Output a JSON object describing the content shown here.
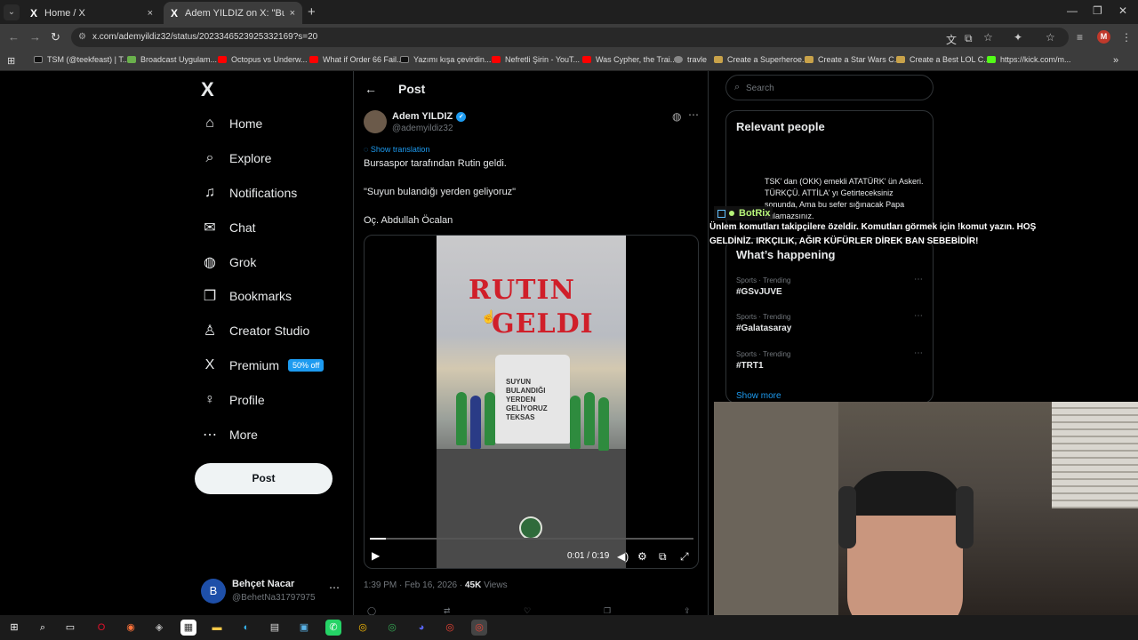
{
  "browser": {
    "tabs": [
      {
        "label": "Home / X",
        "close": "×"
      },
      {
        "label": "Adem YILDIZ on X: \"Bursaspor t",
        "close": "×"
      }
    ],
    "new_tab": "+",
    "url": "x.com/ademyildiz32/status/2023346523925332169?s=20",
    "bookmarks": [
      {
        "label": "TSM (@teekfeast) | T...",
        "color": "#000000"
      },
      {
        "label": "Broadcast Uygulam...",
        "color": "#6ab04c"
      },
      {
        "label": "Octopus vs Underw...",
        "color": "#ff0000"
      },
      {
        "label": "What if Order 66 Fail...",
        "color": "#ff0000"
      },
      {
        "label": "Yazımı kışa çevirdin...",
        "color": "#000000"
      },
      {
        "label": "Nefretli Şirin - YouT...",
        "color": "#ff0000"
      },
      {
        "label": "Was Cypher, the Trai...",
        "color": "#ff0000"
      },
      {
        "label": "travle",
        "color": "#888888"
      },
      {
        "label": "Create a Superheroe...",
        "color": "#c8a24a"
      },
      {
        "label": "Create a Star Wars C...",
        "color": "#c8a24a"
      },
      {
        "label": "Create a Best LOL C...",
        "color": "#c8a24a"
      },
      {
        "label": "https://kick.com/m...",
        "color": "#53fc18"
      }
    ],
    "profile_initial": "M"
  },
  "sidebar": {
    "logo": "X",
    "items": [
      {
        "label": "Home",
        "icon": "⌂"
      },
      {
        "label": "Explore",
        "icon": "⌕"
      },
      {
        "label": "Notifications",
        "icon": "♫"
      },
      {
        "label": "Chat",
        "icon": "✉"
      },
      {
        "label": "Grok",
        "icon": "◍"
      },
      {
        "label": "Bookmarks",
        "icon": "❐"
      },
      {
        "label": "Creator Studio",
        "icon": "♙"
      },
      {
        "label": "Premium",
        "icon": "X"
      },
      {
        "label": "Profile",
        "icon": "♀"
      },
      {
        "label": "More",
        "icon": "⋯"
      }
    ],
    "premium_badge": "50% off",
    "post_button": "Post",
    "account": {
      "initial": "B",
      "name": "Behçet Nacar",
      "handle": "@BehetNa31797975",
      "more": "⋯"
    }
  },
  "post": {
    "header": "Post",
    "author_name": "Adem YILDIZ",
    "author_handle": "@ademyildiz32",
    "show_translation": "Show translation",
    "lines": [
      "Bursaspor tarafından Rutin geldi.",
      "\"Suyun bulandığı yerden geliyoruz\"",
      "Oç. Abdullah Öcalan"
    ],
    "video": {
      "caption_line1": "RUTIN",
      "caption_line2": "GELDI",
      "van_text": "SUYUN\nBULANDIĞI\nYERDEN\nGELİYORUZ\nTEKSAS",
      "time": "0:01 / 0:19",
      "progress": 0.05
    },
    "timestamp": "1:39 PM · Feb 16, 2026 ·",
    "views_count": "45K",
    "views_label": "Views"
  },
  "right": {
    "search_placeholder": "Search",
    "relevant_title": "Relevant people",
    "relevant_bio": "TSK' dan (OKK) emekli ATATÜRK' ün Askeri. TÜRKÇÜ. ATTİLA' yı Getirteceksiniz sonunda, Ama bu sefer sığınacak Papa bulamazsınız.",
    "happening_title": "What’s happening",
    "trends": [
      {
        "category": "Sports · Trending",
        "name": "#GSvJUVE"
      },
      {
        "category": "Sports · Trending",
        "name": "#Galatasaray"
      },
      {
        "category": "Sports · Trending",
        "name": "#TRT1"
      }
    ],
    "show_more": "Show more"
  },
  "overlay": {
    "bot_name": "BotRix",
    "message": "Ünlem komutları takipçilere özeldir. Komutları görmek için !komut yazın. HOŞ GELDİNİZ. IRKÇILIK, AĞIR KÜFÜRLER DİREK BAN SEBEBİDİR!"
  }
}
